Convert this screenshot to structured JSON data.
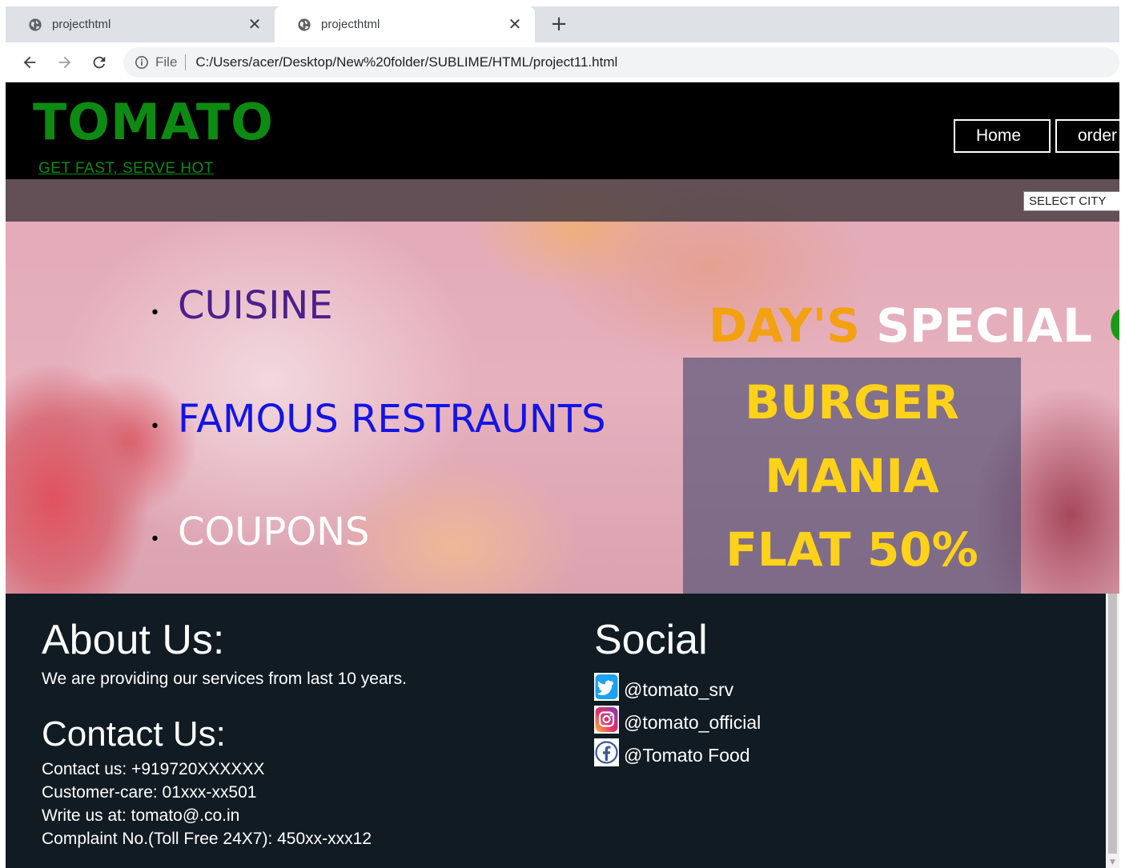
{
  "browser": {
    "tabs": [
      {
        "title": "projecthtml",
        "close": "✕"
      },
      {
        "title": "projecthtml",
        "close": "✕"
      }
    ],
    "new_tab": "+",
    "address": {
      "scheme_label": "File",
      "url": "C:/Users/acer/Desktop/New%20folder/SUBLIME/HTML/project11.html"
    }
  },
  "header": {
    "logo": "TOMATO",
    "tagline": "GET FAST, SERVE HOT",
    "nav": [
      {
        "label": "Home"
      },
      {
        "label": "order"
      }
    ]
  },
  "hero": {
    "city_select": "SELECT CITY",
    "menu": [
      {
        "label": "CUISINE"
      },
      {
        "label": "FAMOUS RESTRAUNTS"
      },
      {
        "label": "COUPONS"
      }
    ],
    "special": {
      "word1": "DAY'S",
      "word2": "SPECIAL",
      "word3": "O"
    },
    "offer": [
      "BURGER",
      "MANIA",
      "FLAT 50%"
    ]
  },
  "footer": {
    "about": {
      "heading": "About Us:",
      "text": "We are providing our services from last 10 years."
    },
    "contact": {
      "heading": "Contact Us:",
      "lines": [
        "Contact us: +919720XXXXXX",
        "Customer-care: 01xxx-xx501",
        "Write us at: tomato@.co.in",
        "Complaint No.(Toll Free 24X7): 450xx-xxx12"
      ]
    },
    "social": {
      "heading": "Social",
      "items": [
        {
          "icon": "twitter-icon",
          "label": "@tomato_srv"
        },
        {
          "icon": "instagram-icon",
          "label": "@tomato_official"
        },
        {
          "icon": "facebook-icon",
          "label": "@Tomato Food"
        }
      ]
    }
  },
  "colors": {
    "logo_green": "#0d8a12",
    "header_bg": "#000000",
    "footer_bg": "#111b23",
    "offer_yellow": "#ffd21a",
    "special_orange": "#f3a110"
  }
}
